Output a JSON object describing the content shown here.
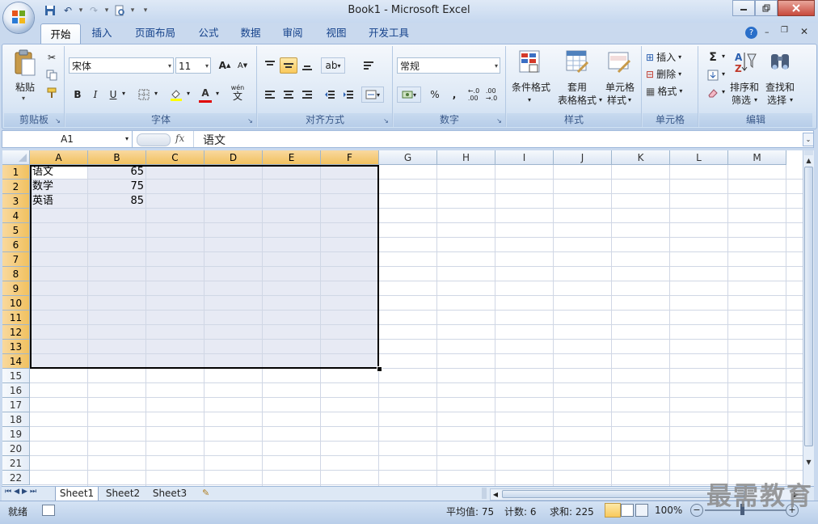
{
  "window": {
    "title": "Book1 - Microsoft Excel"
  },
  "tabs": [
    "开始",
    "插入",
    "页面布局",
    "公式",
    "数据",
    "审阅",
    "视图",
    "开发工具"
  ],
  "ribbon": {
    "clipboard": {
      "paste": "粘贴",
      "label": "剪贴板"
    },
    "font": {
      "name": "宋体",
      "size": "11",
      "bold": "B",
      "italic": "I",
      "underline": "U",
      "font_color": "A",
      "label": "字体",
      "phonetic": "wén"
    },
    "alignment": {
      "label": "对齐方式"
    },
    "number": {
      "format": "常规",
      "percent": "%",
      "comma": ",",
      "label": "数字"
    },
    "styles": {
      "conditional": "条件格式",
      "table_style_1": "套用",
      "table_style_2": "表格格式",
      "cell_style_1": "单元格",
      "cell_style_2": "样式",
      "label": "样式"
    },
    "cells": {
      "insert": "插入",
      "delete": "删除",
      "format": "格式",
      "label": "单元格"
    },
    "editing": {
      "sort_1": "排序和",
      "sort_2": "筛选",
      "find_1": "查找和",
      "find_2": "选择",
      "label": "编辑",
      "sum": "Σ"
    }
  },
  "formula_bar": {
    "name_box": "A1",
    "fx": "fx",
    "content": "语文"
  },
  "columns": [
    "A",
    "B",
    "C",
    "D",
    "E",
    "F",
    "G",
    "H",
    "I",
    "J",
    "K",
    "L",
    "M"
  ],
  "rows": [
    "1",
    "2",
    "3",
    "4",
    "5",
    "6",
    "7",
    "8",
    "9",
    "10",
    "11",
    "12",
    "13",
    "14",
    "15",
    "16",
    "17",
    "18",
    "19",
    "20",
    "21",
    "22"
  ],
  "cells": [
    {
      "a": "语文",
      "b": "65"
    },
    {
      "a": "数学",
      "b": "75"
    },
    {
      "a": "英语",
      "b": "85"
    }
  ],
  "sheets": [
    "Sheet1",
    "Sheet2",
    "Sheet3"
  ],
  "status": {
    "ready": "就绪",
    "average": "平均值: 75",
    "count": "计数: 6",
    "sum": "求和: 225",
    "zoom": "100%"
  },
  "watermark": "最需教育"
}
